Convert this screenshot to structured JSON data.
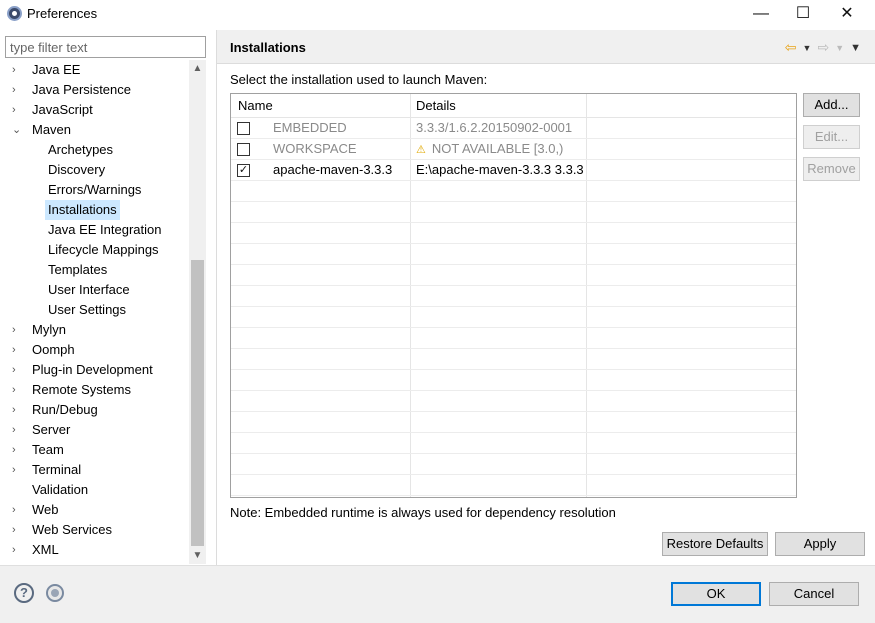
{
  "window": {
    "title": "Preferences",
    "minimize": "—",
    "maximize": "☐",
    "close": "✕"
  },
  "filter": {
    "placeholder": "type filter text",
    "value": ""
  },
  "tree": {
    "items": [
      {
        "label": "Java EE",
        "expanded": false
      },
      {
        "label": "Java Persistence",
        "expanded": false
      },
      {
        "label": "JavaScript",
        "expanded": false
      },
      {
        "label": "Maven",
        "expanded": true
      },
      {
        "label": "Archetypes",
        "child": true
      },
      {
        "label": "Discovery",
        "child": true
      },
      {
        "label": "Errors/Warnings",
        "child": true
      },
      {
        "label": "Installations",
        "child": true,
        "selected": true
      },
      {
        "label": "Java EE Integration",
        "child": true
      },
      {
        "label": "Lifecycle Mappings",
        "child": true
      },
      {
        "label": "Templates",
        "child": true
      },
      {
        "label": "User Interface",
        "child": true
      },
      {
        "label": "User Settings",
        "child": true
      },
      {
        "label": "Mylyn",
        "expanded": false
      },
      {
        "label": "Oomph",
        "expanded": false
      },
      {
        "label": "Plug-in Development",
        "expanded": false
      },
      {
        "label": "Remote Systems",
        "expanded": false
      },
      {
        "label": "Run/Debug",
        "expanded": false
      },
      {
        "label": "Server",
        "expanded": false
      },
      {
        "label": "Team",
        "expanded": false
      },
      {
        "label": "Terminal",
        "expanded": false
      },
      {
        "label": "Validation",
        "leaf": true
      },
      {
        "label": "Web",
        "expanded": false
      },
      {
        "label": "Web Services",
        "expanded": false
      },
      {
        "label": "XML",
        "expanded": false
      }
    ]
  },
  "page": {
    "title": "Installations",
    "instruction": "Select the installation used to launch Maven:",
    "note": "Note: Embedded runtime is always used for dependency resolution"
  },
  "table": {
    "columns": [
      "Name",
      "Details"
    ],
    "rows": [
      {
        "checked": false,
        "name": "EMBEDDED",
        "details": "3.3.3/1.6.2.20150902-0001",
        "dim": true,
        "warning": false
      },
      {
        "checked": false,
        "name": "WORKSPACE",
        "details": "NOT AVAILABLE [3.0,)",
        "dim": true,
        "warning": true
      },
      {
        "checked": true,
        "name": "apache-maven-3.3.3",
        "details": "E:\\apache-maven-3.3.3 3.3.3",
        "dim": false,
        "warning": false
      }
    ]
  },
  "buttons": {
    "add": "Add...",
    "edit": "Edit...",
    "remove": "Remove",
    "restore_defaults": "Restore Defaults",
    "apply": "Apply",
    "ok": "OK",
    "cancel": "Cancel"
  },
  "icons": {
    "check": "✓",
    "warning": "⚠",
    "back": "⇦",
    "forward": "⇨",
    "dropdown": "▼",
    "expand": "›",
    "collapse": "⌄"
  }
}
